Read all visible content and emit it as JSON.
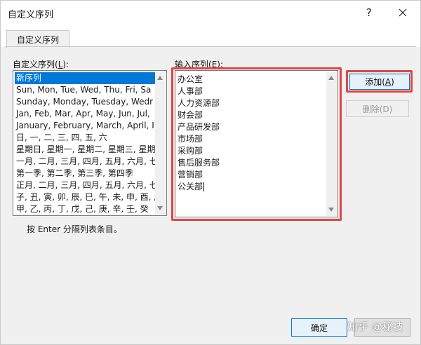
{
  "window": {
    "title": "自定义序列",
    "help_glyph": "?",
    "close_label": "close"
  },
  "tabs": [
    {
      "label": "自定义序列"
    }
  ],
  "left": {
    "label_prefix": "自定义序列(",
    "label_key": "L",
    "label_suffix": "):",
    "items": [
      "新序列",
      "Sun, Mon, Tue, Wed, Thu, Fri, Sa",
      "Sunday, Monday, Tuesday, Wedr",
      "Jan, Feb, Mar, Apr, May, Jun, Jul,",
      "January, February, March, April, I",
      "日, 一, 二, 三, 四, 五, 六",
      "星期日, 星期一, 星期二, 星期三, 星期",
      "一月, 二月, 三月, 四月, 五月, 六月, 七",
      "第一季, 第二季, 第三季, 第四季",
      "正月, 二月, 三月, 四月, 五月, 六月, 七",
      "子, 丑, 寅, 卯, 辰, 巳, 午, 未, 申, 酉, 戌",
      "甲, 乙, 丙, 丁, 戊, 己, 庚, 辛, 壬, 癸"
    ],
    "selected_index": 0
  },
  "right": {
    "label_prefix": "输入序列(",
    "label_key": "E",
    "label_suffix": "):",
    "entries": [
      "办公室",
      "人事部",
      "人力资源部",
      "财会部",
      "产品研发部",
      "市场部",
      "采购部",
      "售后服务部",
      "营销部",
      "公关部"
    ]
  },
  "buttons": {
    "add_prefix": "添加(",
    "add_key": "A",
    "add_suffix": ")",
    "delete": "删除(D)",
    "ok": "确定",
    "cancel": ""
  },
  "hint": "按 Enter 分隔列表条目。",
  "watermark": "知乎 @秘技",
  "colors": {
    "highlight_box": "#e04545",
    "selection": "#0078d7"
  }
}
